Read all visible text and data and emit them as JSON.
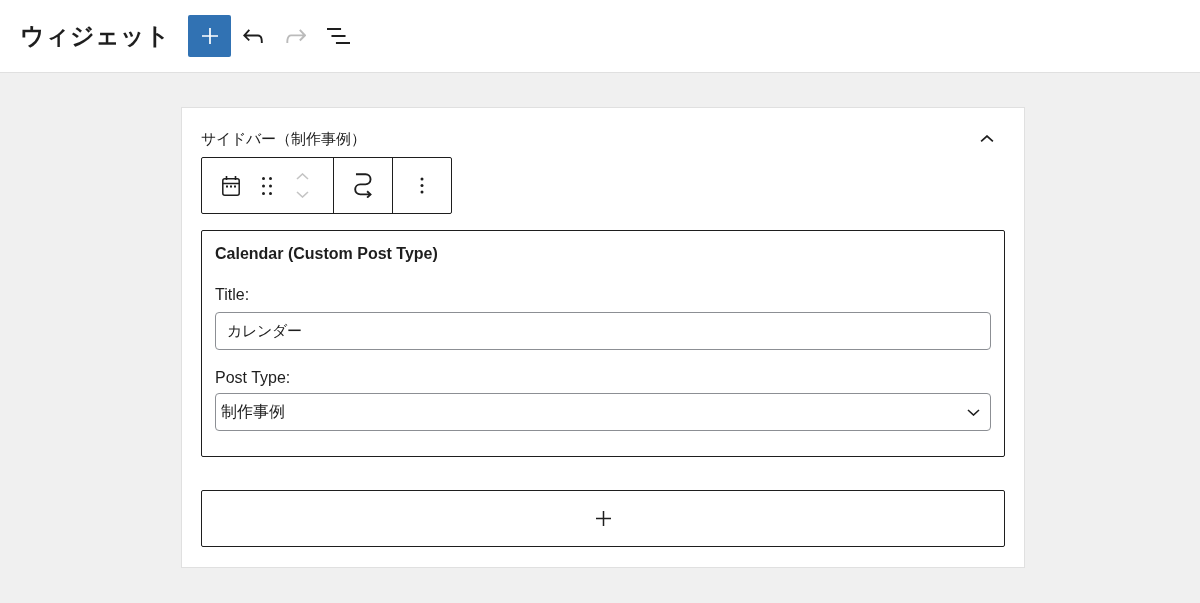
{
  "header": {
    "title": "ウィジェット",
    "tools": [
      {
        "kind": "add",
        "disabled": false
      },
      {
        "kind": "undo",
        "disabled": false
      },
      {
        "kind": "redo",
        "disabled": true
      },
      {
        "kind": "list-view",
        "disabled": false
      }
    ]
  },
  "widget_area": {
    "title": "サイドバー（制作事例）",
    "expanded": true,
    "block_toolbar": {
      "mover": [
        {
          "kind": "up",
          "disabled": true
        },
        {
          "kind": "down",
          "disabled": true
        }
      ]
    },
    "widget": {
      "title": "Calendar (Custom Post Type)",
      "fields": [
        {
          "kind": "text",
          "label": "Title:",
          "value": "カレンダー"
        },
        {
          "kind": "select",
          "label": "Post Type:",
          "value": "制作事例"
        }
      ]
    }
  }
}
